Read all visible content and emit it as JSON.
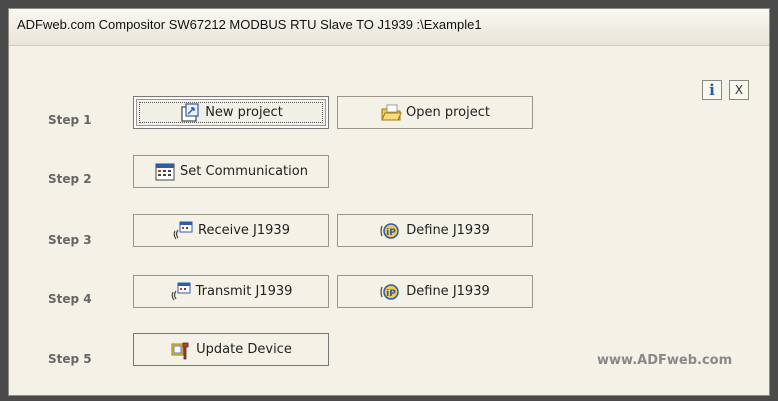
{
  "window": {
    "title": "ADFweb.com Compositor SW67212 MODBUS RTU Slave TO J1939 :\\Example1"
  },
  "header_buttons": {
    "info": "i",
    "close": "X"
  },
  "steps": [
    {
      "label": "Step 1",
      "buttons": [
        {
          "label": "New project",
          "icon": "new-project-icon"
        },
        {
          "label": "Open project",
          "icon": "folder-icon"
        }
      ]
    },
    {
      "label": "Step 2",
      "buttons": [
        {
          "label": "Set Communication",
          "icon": "communication-table-icon"
        }
      ]
    },
    {
      "label": "Step 3",
      "buttons": [
        {
          "label": "Receive J1939",
          "icon": "receive-icon"
        },
        {
          "label": "Define J1939",
          "icon": "define-icon"
        }
      ]
    },
    {
      "label": "Step 4",
      "buttons": [
        {
          "label": "Transmit J1939",
          "icon": "transmit-icon"
        },
        {
          "label": "Define J1939",
          "icon": "define-icon"
        }
      ]
    },
    {
      "label": "Step 5",
      "buttons": [
        {
          "label": "Update Device",
          "icon": "update-device-icon"
        }
      ]
    }
  ],
  "footer": {
    "website": "www.ADFweb.com"
  },
  "colors": {
    "window_bg": "#f4f1e6",
    "step_label": "#666666",
    "info_blue": "#1f5fb3",
    "folder_yellow": "#f2c94c"
  }
}
